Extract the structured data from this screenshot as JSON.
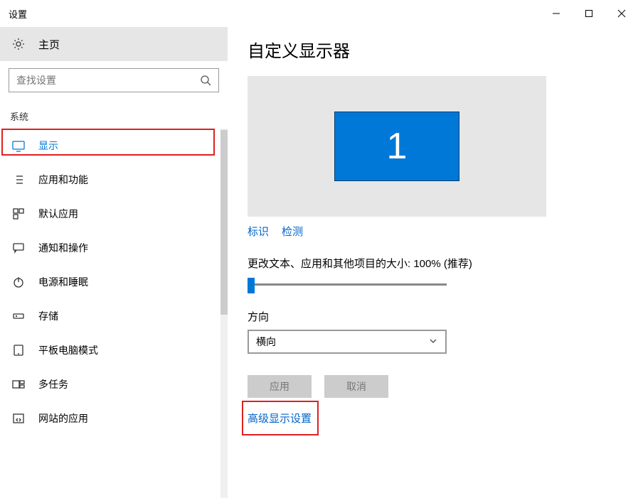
{
  "window": {
    "title": "设置"
  },
  "sidebar": {
    "home": "主页",
    "search_placeholder": "查找设置",
    "section": "系统",
    "items": [
      {
        "label": "显示"
      },
      {
        "label": "应用和功能"
      },
      {
        "label": "默认应用"
      },
      {
        "label": "通知和操作"
      },
      {
        "label": "电源和睡眠"
      },
      {
        "label": "存储"
      },
      {
        "label": "平板电脑模式"
      },
      {
        "label": "多任务"
      },
      {
        "label": "网站的应用"
      }
    ]
  },
  "main": {
    "title": "自定义显示器",
    "monitor_number": "1",
    "identify": "标识",
    "detect": "检测",
    "scale_label": "更改文本、应用和其他项目的大小: 100% (推荐)",
    "orientation_label": "方向",
    "orientation_value": "横向",
    "apply": "应用",
    "cancel": "取消",
    "advanced": "高级显示设置"
  }
}
